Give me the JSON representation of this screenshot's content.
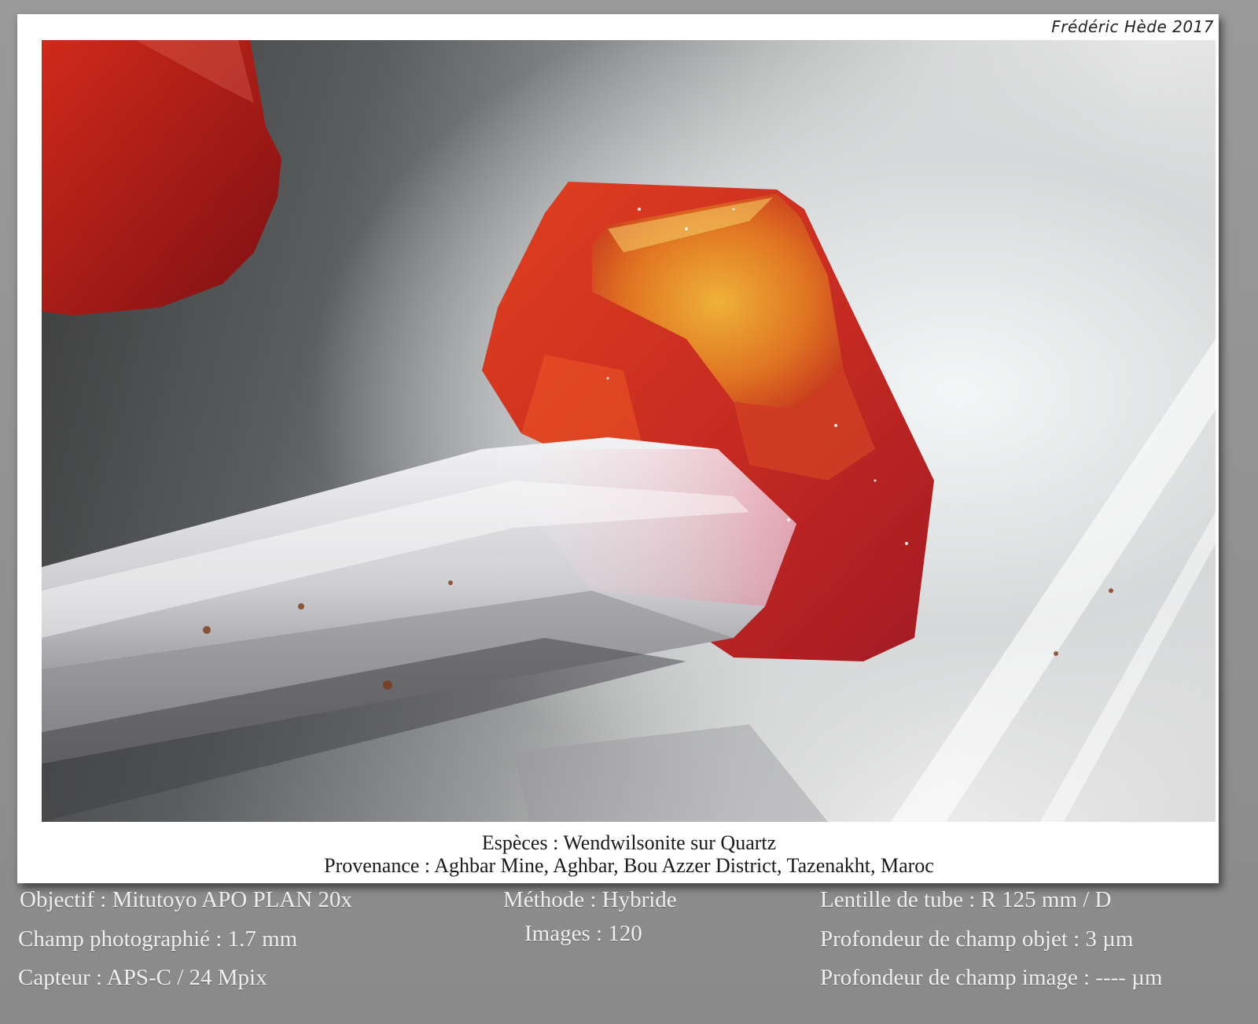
{
  "credit": "Frédéric Hède 2017",
  "caption": {
    "species": "Espèces : Wendwilsonite sur Quartz",
    "provenance": "Provenance : Aghbar Mine, Aghbar, Bou Azzer District, Tazenakht, Maroc"
  },
  "specs": {
    "objective": "Objectif : Mitutoyo APO PLAN 20x",
    "field": "Champ photographié : 1.7 mm",
    "sensor": "Capteur : APS-C / 24 Mpix",
    "method": "Méthode : Hybride",
    "images": "Images : 120",
    "tube_lens": "Lentille de tube : R 125 mm / D",
    "object_dof": "Profondeur de champ objet : 3 µm",
    "image_dof": "Profondeur de champ image : ---- µm"
  },
  "colors": {
    "background": "#8f8f8f",
    "card": "#ffffff",
    "crystal_red": "#d4321e",
    "crystal_orange": "#e8a020",
    "quartz": "#e6e6e8"
  }
}
